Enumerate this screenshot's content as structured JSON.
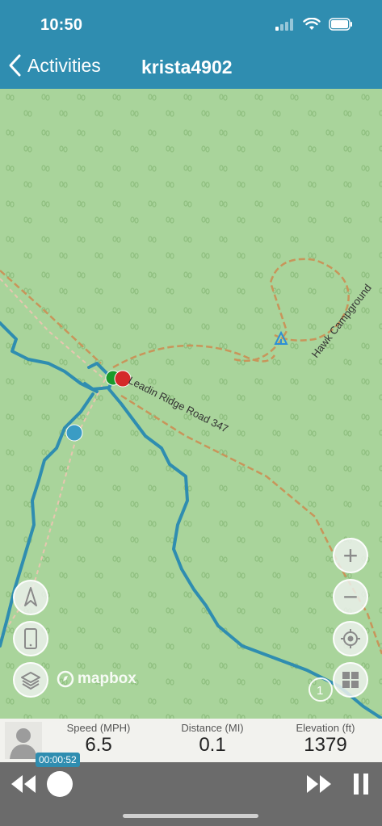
{
  "status_bar": {
    "time": "10:50"
  },
  "nav": {
    "back_label": "Activities",
    "title": "krista4902"
  },
  "map": {
    "road_label": "Leadin Ridge Road 347",
    "campground_label": "Hawk Campground",
    "attribution": "mapbox",
    "zoom_in": "+",
    "zoom_out": "−",
    "badge_count": "1",
    "colors": {
      "land": "#a9d49b",
      "track": "#2f8db0",
      "trail": "#c8955a",
      "start": "#1a9a2a",
      "end": "#d42a2a"
    }
  },
  "stats": {
    "speed": {
      "label": "Speed (MPH)",
      "value": "6.5"
    },
    "distance": {
      "label": "Distance (MI)",
      "value": "0.1"
    },
    "elevation": {
      "label": "Elevation (ft)",
      "value": "1379"
    }
  },
  "playback": {
    "elapsed": "00:00:52"
  }
}
